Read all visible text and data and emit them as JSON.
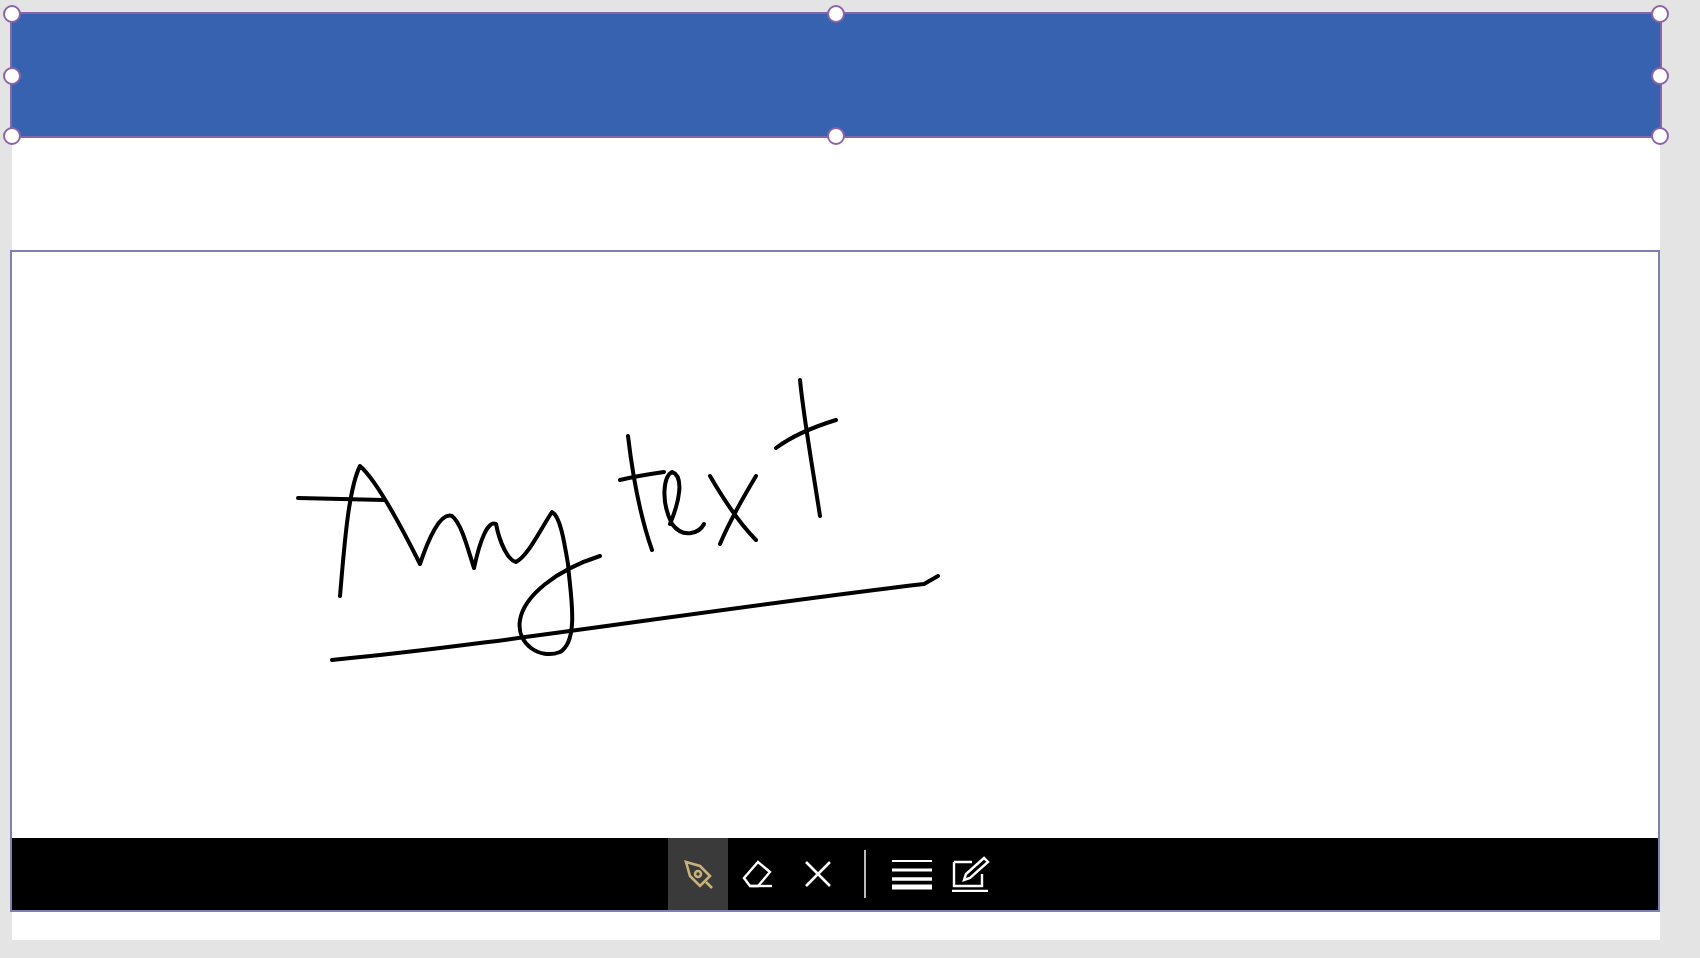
{
  "header": {
    "selected": true
  },
  "pen_input": {
    "toolbar": [
      {
        "kind": "pen",
        "selected": true
      },
      {
        "kind": "eraser",
        "selected": false
      },
      {
        "kind": "clear",
        "selected": false
      },
      {
        "kind": "separator"
      },
      {
        "kind": "thickness",
        "selected": false
      },
      {
        "kind": "edit",
        "selected": false
      }
    ]
  }
}
